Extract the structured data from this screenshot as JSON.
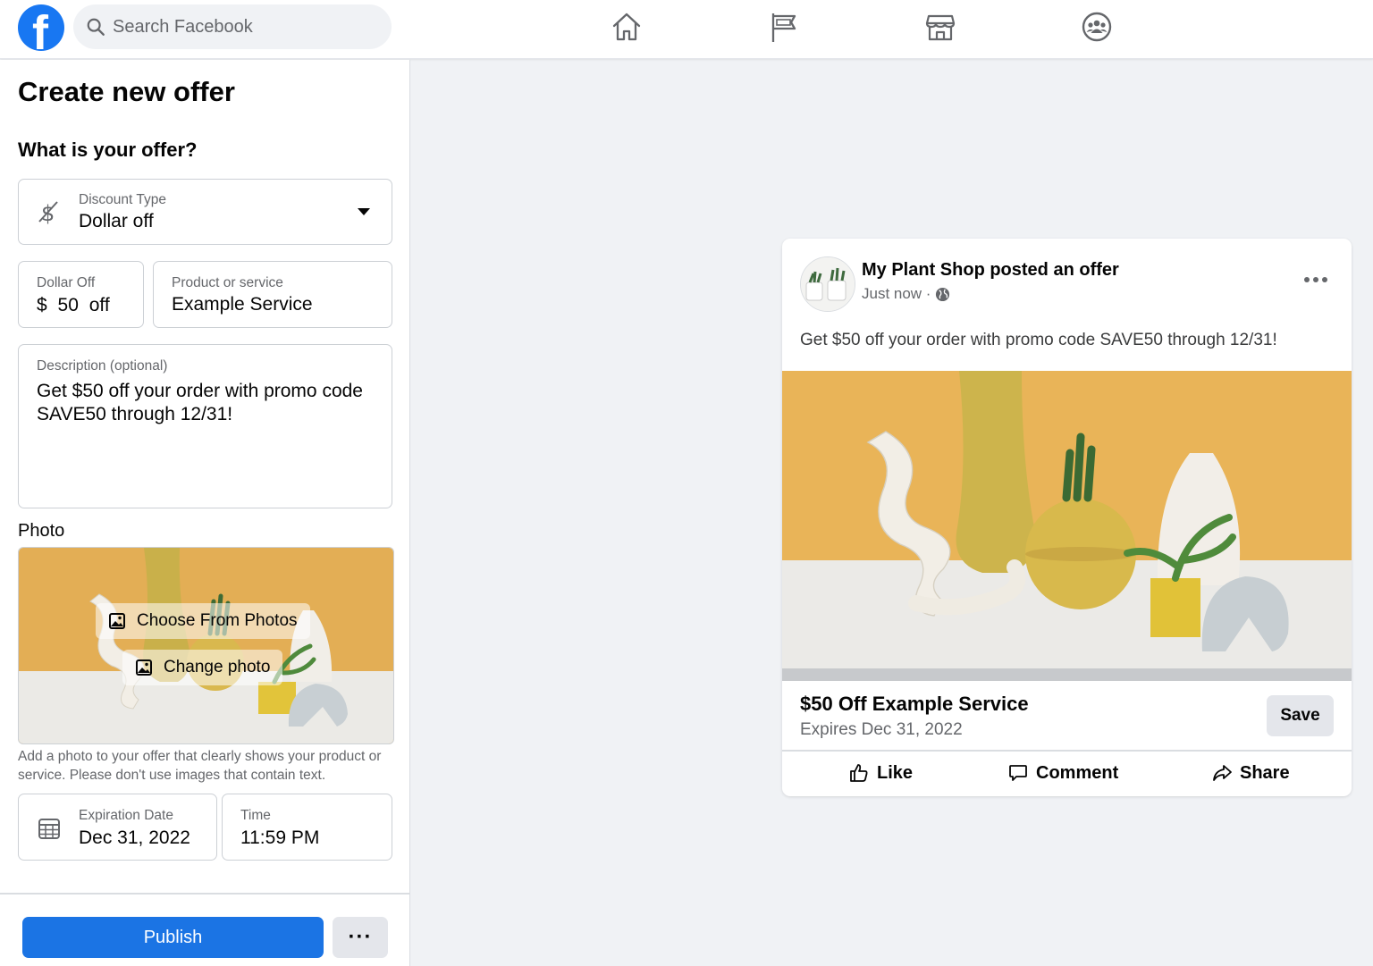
{
  "topbar": {
    "logo_letter": "f",
    "search_placeholder": "Search Facebook",
    "nav_icons": [
      "home-icon",
      "flag-icon",
      "marketplace-icon",
      "groups-icon"
    ]
  },
  "form": {
    "title": "Create new offer",
    "offer_heading": "What is your offer?",
    "discount_type": {
      "label": "Discount Type",
      "value": "Dollar off",
      "icon": "no-dollar-icon"
    },
    "dollar_off": {
      "label": "Dollar Off",
      "currency": "$",
      "amount": "50",
      "suffix": "off"
    },
    "product": {
      "label": "Product or service",
      "value": "Example Service"
    },
    "description": {
      "label": "Description (optional)",
      "value": "Get $50 off your order with promo code SAVE50 through 12/31!"
    },
    "photo_heading": "Photo",
    "choose_photos_label": "Choose From Photos",
    "change_photo_label": "Change photo",
    "photo_help": "Add a photo to your offer that clearly shows your product or service. Please don't use images that contain text.",
    "expiration": {
      "label": "Expiration Date",
      "value": "Dec 31, 2022",
      "icon": "calendar-icon"
    },
    "time": {
      "label": "Time",
      "value": "11:59 PM"
    },
    "publish_label": "Publish",
    "more_label": "···"
  },
  "post": {
    "author_line": "My Plant Shop posted an offer",
    "time": "Just now ·",
    "text": "Get $50 off your order with promo code SAVE50 through 12/31!",
    "offer_title": "$50 Off Example Service",
    "offer_expiry": "Expires Dec 31, 2022",
    "save_label": "Save",
    "actions": {
      "like": "Like",
      "comment": "Comment",
      "share": "Share"
    }
  },
  "colors": {
    "brand": "#1877f2",
    "publish": "#1b74e4",
    "photo_wall": "#e8b45a",
    "photo_table": "#ebebea"
  }
}
